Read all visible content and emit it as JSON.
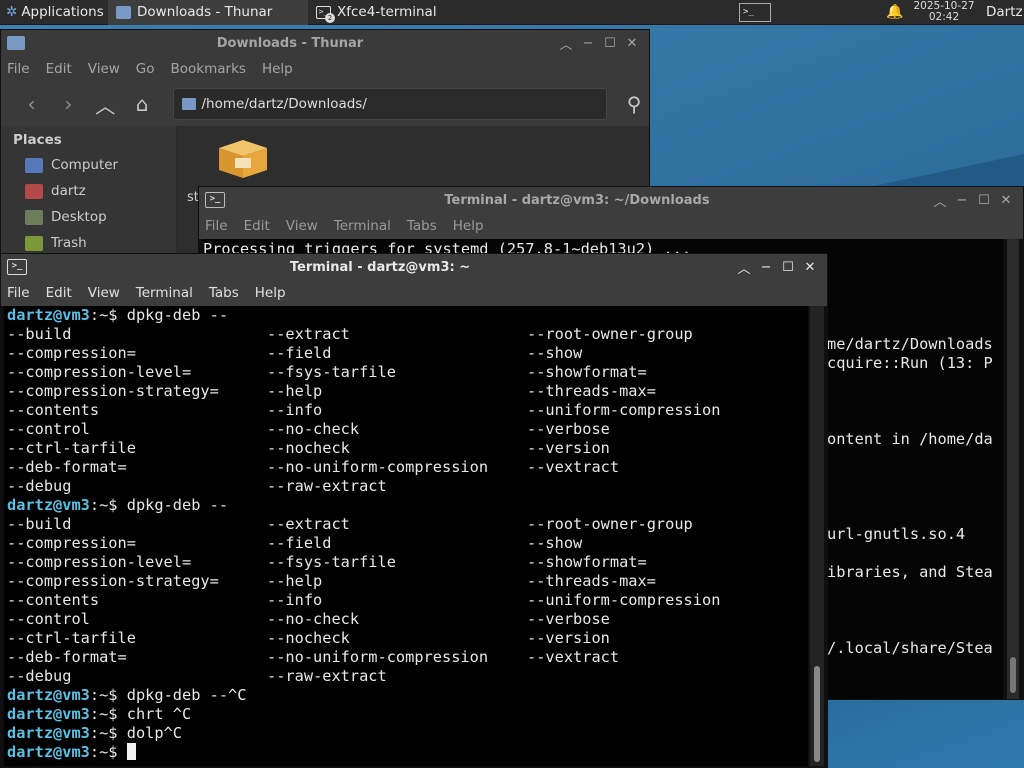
{
  "panel": {
    "app_menu": "Applications",
    "tasks": [
      {
        "label": "Downloads - Thunar"
      },
      {
        "label": "Xfce4-terminal",
        "badge": "2"
      }
    ],
    "clock_date": "2025-10-27",
    "clock_time": "02:42",
    "user": "Dartz",
    "workspace": ">_"
  },
  "thunar": {
    "title": "Downloads - Thunar",
    "menu": [
      "File",
      "Edit",
      "View",
      "Go",
      "Bookmarks",
      "Help"
    ],
    "location": "/home/dartz/Downloads/",
    "places_header": "Places",
    "places": [
      {
        "label": "Computer",
        "icon": "computer-icon"
      },
      {
        "label": "dartz",
        "icon": "home-icon"
      },
      {
        "label": "Desktop",
        "icon": "desktop-icon"
      },
      {
        "label": "Trash",
        "icon": "trash-icon"
      }
    ],
    "file_label": "st"
  },
  "term_back": {
    "title": "Terminal - dartz@vm3: ~/Downloads",
    "menu": [
      "File",
      "Edit",
      "View",
      "Terminal",
      "Tabs",
      "Help"
    ],
    "top_line": "Processing triggers for systemd (257.8-1~deb13u2) ...",
    "right_lines": [
      {
        "row": 5,
        "text": "me/dartz/Downloads"
      },
      {
        "row": 6,
        "text": "cquire::Run (13: P"
      },
      {
        "row": 10,
        "text": "ontent in /home/da"
      },
      {
        "row": 15,
        "text": "url-gnutls.so.4"
      },
      {
        "row": 17,
        "text": "ibraries, and Stea"
      },
      {
        "row": 21,
        "text": "/.local/share/Stea"
      }
    ]
  },
  "term_front": {
    "title": "Terminal - dartz@vm3: ~",
    "menu": [
      "File",
      "Edit",
      "View",
      "Terminal",
      "Tabs",
      "Help"
    ],
    "prompt_user": "dartz@vm3",
    "prompt_suffix": ":~$ ",
    "completion_rows": [
      [
        "--build",
        "--extract",
        "--root-owner-group"
      ],
      [
        "--compression=",
        "--field",
        "--show"
      ],
      [
        "--compression-level=",
        "--fsys-tarfile",
        "--showformat="
      ],
      [
        "--compression-strategy=",
        "--help",
        "--threads-max="
      ],
      [
        "--contents",
        "--info",
        "--uniform-compression"
      ],
      [
        "--control",
        "--no-check",
        "--verbose"
      ],
      [
        "--ctrl-tarfile",
        "--nocheck",
        "--version"
      ],
      [
        "--deb-format=",
        "--no-uniform-compression",
        "--vextract"
      ],
      [
        "--debug",
        "--raw-extract",
        ""
      ]
    ],
    "commands": [
      "dpkg-deb --",
      "dpkg-deb --",
      "dpkg-deb --^C",
      "chrt ^C",
      "dolp^C",
      ""
    ]
  }
}
